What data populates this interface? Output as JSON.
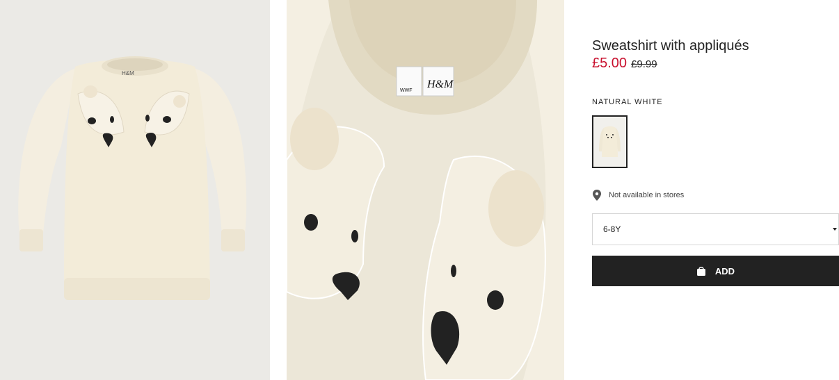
{
  "product": {
    "title": "Sweatshirt with appliqués",
    "price_sale": "£5.00",
    "price_original": "£9.99",
    "color_name": "NATURAL WHITE",
    "availability": "Not available in stores",
    "size_selected": "6-8Y",
    "add_label": "ADD"
  },
  "images": {
    "main_label_text": "H&M",
    "detail_brand_text": "H&M",
    "detail_wwf_text": "WWF"
  },
  "colors": {
    "sale_price": "#c8102e",
    "button_bg": "#222222",
    "garment": "#f3ecd9"
  },
  "icons": {
    "availability_icon": "location-pin-icon",
    "add_icon": "shopping-bag-icon",
    "select_icon": "caret-down-icon"
  }
}
